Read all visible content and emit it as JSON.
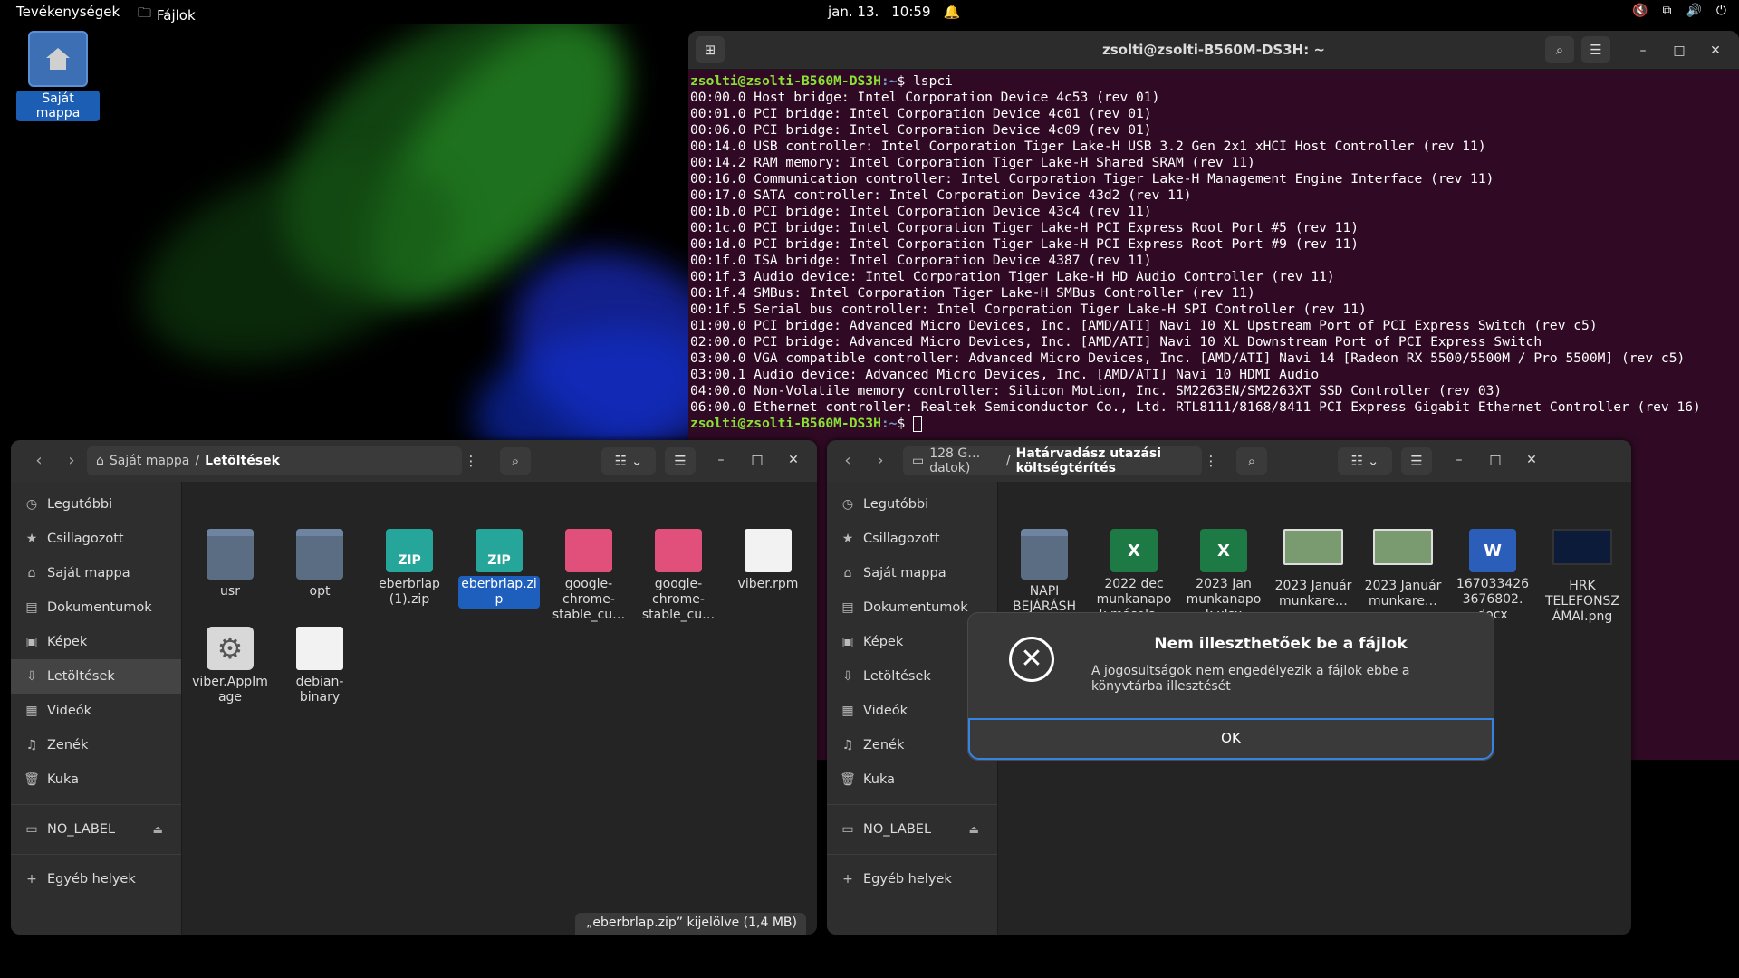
{
  "topbar": {
    "activities": "Tevékenységek",
    "app_name": "Fájlok",
    "date": "jan. 13.",
    "time": "10:59"
  },
  "desktop": {
    "home_label": "Saját mappa"
  },
  "terminal": {
    "title": "zsolti@zsolti-B560M-DS3H: ~",
    "prompt_user": "zsolti@zsolti-B560M-DS3H",
    "prompt_path": ":~",
    "command": "$ lspci",
    "lines": [
      "00:00.0 Host bridge: Intel Corporation Device 4c53 (rev 01)",
      "00:01.0 PCI bridge: Intel Corporation Device 4c01 (rev 01)",
      "00:06.0 PCI bridge: Intel Corporation Device 4c09 (rev 01)",
      "00:14.0 USB controller: Intel Corporation Tiger Lake-H USB 3.2 Gen 2x1 xHCI Host Controller (rev 11)",
      "00:14.2 RAM memory: Intel Corporation Tiger Lake-H Shared SRAM (rev 11)",
      "00:16.0 Communication controller: Intel Corporation Tiger Lake-H Management Engine Interface (rev 11)",
      "00:17.0 SATA controller: Intel Corporation Device 43d2 (rev 11)",
      "00:1b.0 PCI bridge: Intel Corporation Device 43c4 (rev 11)",
      "00:1c.0 PCI bridge: Intel Corporation Tiger Lake-H PCI Express Root Port #5 (rev 11)",
      "00:1d.0 PCI bridge: Intel Corporation Tiger Lake-H PCI Express Root Port #9 (rev 11)",
      "00:1f.0 ISA bridge: Intel Corporation Device 4387 (rev 11)",
      "00:1f.3 Audio device: Intel Corporation Tiger Lake-H HD Audio Controller (rev 11)",
      "00:1f.4 SMBus: Intel Corporation Tiger Lake-H SMBus Controller (rev 11)",
      "00:1f.5 Serial bus controller: Intel Corporation Tiger Lake-H SPI Controller (rev 11)",
      "01:00.0 PCI bridge: Advanced Micro Devices, Inc. [AMD/ATI] Navi 10 XL Upstream Port of PCI Express Switch (rev c5)",
      "02:00.0 PCI bridge: Advanced Micro Devices, Inc. [AMD/ATI] Navi 10 XL Downstream Port of PCI Express Switch",
      "03:00.0 VGA compatible controller: Advanced Micro Devices, Inc. [AMD/ATI] Navi 14 [Radeon RX 5500/5500M / Pro 5500M] (rev c5)",
      "03:00.1 Audio device: Advanced Micro Devices, Inc. [AMD/ATI] Navi 10 HDMI Audio",
      "04:00.0 Non-Volatile memory controller: Silicon Motion, Inc. SM2263EN/SM2263XT SSD Controller (rev 03)",
      "06:00.0 Ethernet controller: Realtek Semiconductor Co., Ltd. RTL8111/8168/8411 PCI Express Gigabit Ethernet Controller (rev 16)"
    ],
    "final_prompt": "$ "
  },
  "sidebar": {
    "items": [
      "Legutóbbi",
      "Csillagozott",
      "Saját mappa",
      "Dokumentumok",
      "Képek",
      "Letöltések",
      "Videók",
      "Zenék",
      "Kuka"
    ],
    "drive": "NO_LABEL",
    "other": "Egyéb helyek"
  },
  "fm_left": {
    "path_root": "Saját mappa",
    "path_sep": "/",
    "path_current": "Letöltések",
    "files": [
      "usr",
      "opt",
      "eberbrlap (1).zip",
      "eberbrlap.zip",
      "google-chrome-stable_cu…",
      "google-chrome-stable_cu…",
      "viber.rpm",
      "viber.AppImage",
      "debian-binary"
    ],
    "status": "„eberbrlap.zip” kijelölve  (1,4 MB)"
  },
  "fm_right": {
    "path_root": "128 G… datok)",
    "path_sep": "/",
    "path_current": "Határvadász utazási költségtérítés",
    "files": [
      "NAPI BEJÁRÁSH OZ",
      "2022 dec munkanapo k másola…",
      "2023 Jan munkanapo k.xlsx",
      "2023 Január munkare…",
      "2023 Január munkare…",
      "167033426 3676802. docx",
      "HRK TELEFONSZ ÁMAI.png"
    ]
  },
  "dialog": {
    "title": "Nem illeszthetőek be a fájlok",
    "message": "A jogosultságok nem engedélyezik a fájlok ebbe a könyvtárba illesztését",
    "ok": "OK"
  }
}
